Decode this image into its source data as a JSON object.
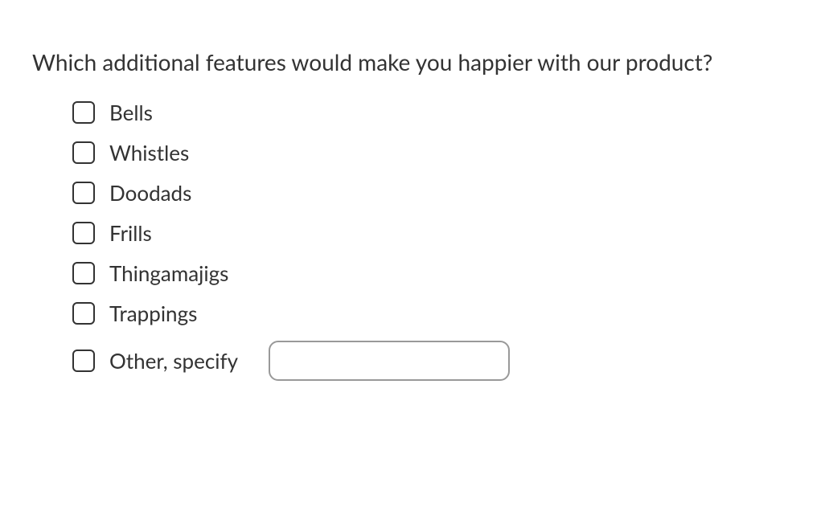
{
  "question": "Which additional features would make you happier with our product?",
  "options": [
    {
      "label": "Bells"
    },
    {
      "label": "Whistles"
    },
    {
      "label": "Doodads"
    },
    {
      "label": "Frills"
    },
    {
      "label": "Thingamajigs"
    },
    {
      "label": "Trappings"
    },
    {
      "label": "Other, specify",
      "hasInput": true
    }
  ]
}
